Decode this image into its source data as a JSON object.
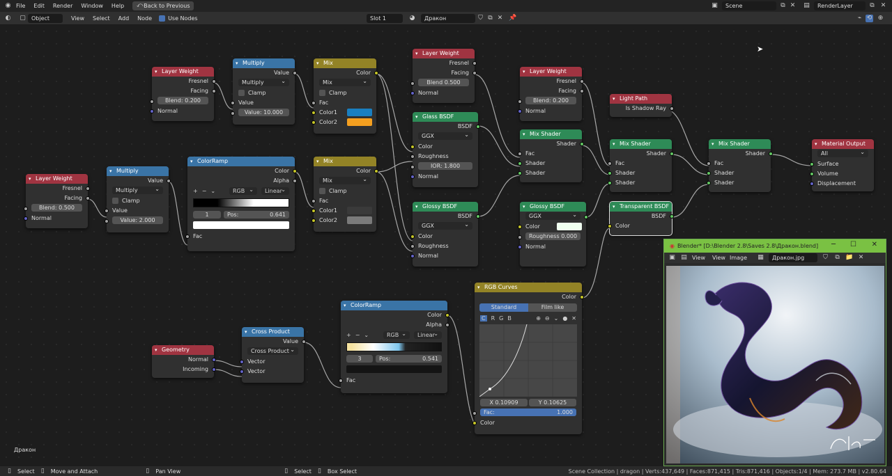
{
  "topbar": {
    "menus": [
      "File",
      "Edit",
      "Render",
      "Window",
      "Help"
    ],
    "back_label": "Back to Previous",
    "scene": "Scene",
    "render_layer": "RenderLayer"
  },
  "header": {
    "mode": "Object",
    "menus": [
      "View",
      "Select",
      "Add",
      "Node"
    ],
    "use_nodes": "Use Nodes",
    "slot": "Slot 1",
    "material": "Дракон"
  },
  "nodes": {
    "lw1": {
      "title": "Layer Weight",
      "fresnel": "Fresnel",
      "facing": "Facing",
      "blend": "Blend:",
      "blend_val": "0.200",
      "normal": "Normal"
    },
    "mul1": {
      "title": "Multiply",
      "value": "Value",
      "op": "Multiply",
      "clamp": "Clamp",
      "in": "Value",
      "val_label": "Value:",
      "val": "10.000"
    },
    "mix1": {
      "title": "Mix",
      "color": "Color",
      "op": "Mix",
      "clamp": "Clamp",
      "fac": "Fac",
      "c1": "Color1",
      "c2": "Color2"
    },
    "lw2": {
      "title": "Layer Weight",
      "fresnel": "Fresnel",
      "facing": "Facing",
      "blend": "Blend",
      "blend_val": "0.500",
      "normal": "Normal"
    },
    "glass": {
      "title": "Glass BSDF",
      "bsdf": "BSDF",
      "dist": "GGX",
      "color": "Color",
      "rough": "Roughness",
      "ior": "IOR:",
      "ior_val": "1.800",
      "normal": "Normal"
    },
    "lw3": {
      "title": "Layer Weight",
      "fresnel": "Fresnel",
      "facing": "Facing",
      "blend": "Blend:",
      "blend_val": "0.200",
      "normal": "Normal"
    },
    "mix_s1": {
      "title": "Mix Shader",
      "shader": "Shader",
      "fac": "Fac",
      "s1": "Shader",
      "s2": "Shader"
    },
    "lightpath": {
      "title": "Light Path",
      "out": "Is Shadow Ray"
    },
    "mix_s2": {
      "title": "Mix Shader",
      "shader": "Shader",
      "fac": "Fac",
      "s1": "Shader",
      "s2": "Shader"
    },
    "mix_s3": {
      "title": "Mix Shader",
      "shader": "Shader",
      "fac": "Fac",
      "s1": "Shader",
      "s2": "Shader"
    },
    "matout": {
      "title": "Material Output",
      "target": "All",
      "surface": "Surface",
      "volume": "Volume",
      "disp": "Displacement"
    },
    "lw4": {
      "title": "Layer Weight",
      "fresnel": "Fresnel",
      "facing": "Facing",
      "blend": "Blend:",
      "blend_val": "0.500",
      "normal": "Normal"
    },
    "mul2": {
      "title": "Multiply",
      "value": "Value",
      "op": "Multiply",
      "clamp": "Clamp",
      "in": "Value",
      "val_label": "Value:",
      "val": "2.000"
    },
    "ramp1": {
      "title": "ColorRamp",
      "color": "Color",
      "alpha": "Alpha",
      "mode": "RGB",
      "interp": "Linear",
      "index": "1",
      "pos": "Pos:",
      "pos_val": "0.641",
      "fac": "Fac"
    },
    "mix2": {
      "title": "Mix",
      "color": "Color",
      "op": "Mix",
      "clamp": "Clamp",
      "fac": "Fac",
      "c1": "Color1",
      "c2": "Color2"
    },
    "glossy1": {
      "title": "Glossy BSDF",
      "bsdf": "BSDF",
      "dist": "GGX",
      "color": "Color",
      "rough": "Roughness",
      "normal": "Normal"
    },
    "glossy2": {
      "title": "Glossy BSDF",
      "bsdf": "BSDF",
      "dist": "GGX",
      "color": "Color",
      "rough": "Roughness",
      "rough_val": "0.000",
      "normal": "Normal"
    },
    "transp": {
      "title": "Transparent BSDF",
      "bsdf": "BSDF",
      "color": "Color"
    },
    "curves": {
      "title": "RGB Curves",
      "color": "Color",
      "tab1": "Standard",
      "tab2": "Film like",
      "ch": [
        "C",
        "R",
        "G",
        "B"
      ],
      "x": "X 0.10909",
      "y": "Y 0.10625",
      "fac": "Fac:",
      "fac_val": "1.000",
      "in": "Color"
    },
    "ramp2": {
      "title": "ColorRamp",
      "color": "Color",
      "alpha": "Alpha",
      "mode": "RGB",
      "interp": "Linear",
      "index": "3",
      "pos": "Pos:",
      "pos_val": "0.541",
      "fac": "Fac"
    },
    "cross": {
      "title": "Cross Product",
      "value": "Value",
      "op": "Cross Product",
      "v1": "Vector",
      "v2": "Vector"
    },
    "geom": {
      "title": "Geometry",
      "normal": "Normal",
      "incoming": "Incoming"
    }
  },
  "canvas_label": "Дракон",
  "image_window": {
    "title": "Blender* [D:\\Blender 2.8\\Saves 2.8\\Дракон.blend]",
    "view": "View",
    "view2": "View",
    "image": "Image",
    "file": "Дракон.jpg"
  },
  "status": {
    "select": "Select",
    "move": "Move and Attach",
    "pan": "Pan View",
    "select2": "Select",
    "box": "Box Select",
    "info": "Scene Collection | dragon | Verts:437,649 | Faces:871,415 | Tris:871,416 | Objects:1/4 | Mem: 273.7 MB | v2.80.64"
  },
  "colors": {
    "mix1_c1": "#1a7fc0",
    "mix1_c2": "#f5a020",
    "mix2_c1": "#3a3a3a",
    "mix2_c2": "#7a7a7a",
    "glossy2_color": "#f0fff0"
  }
}
